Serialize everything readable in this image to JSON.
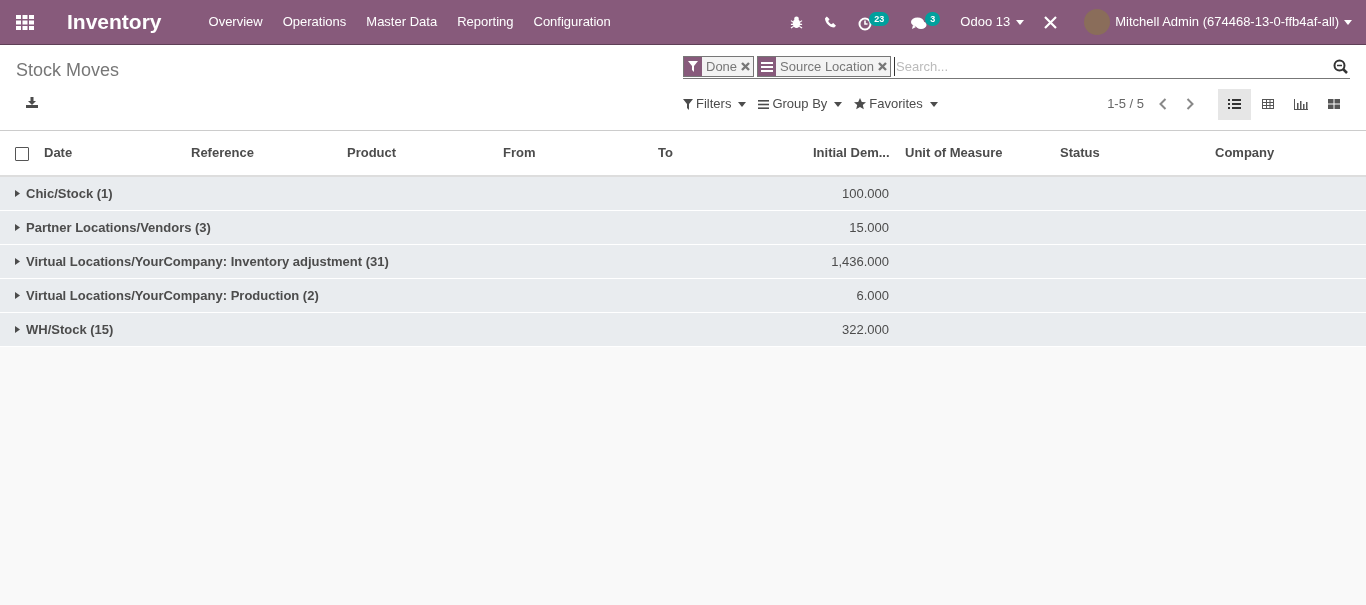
{
  "navbar": {
    "app_name": "Inventory",
    "menu": [
      "Overview",
      "Operations",
      "Master Data",
      "Reporting",
      "Configuration"
    ],
    "activity_count": "23",
    "message_count": "3",
    "database": "Odoo 13",
    "user": "Mitchell Admin (674468-13-0-ffb4af-all)"
  },
  "control_panel": {
    "title": "Stock Moves",
    "facets": [
      {
        "kind": "filter",
        "label": "Done"
      },
      {
        "kind": "groupby",
        "label": "Source Location"
      }
    ],
    "search": {
      "placeholder": "Search..."
    },
    "search_menus": [
      {
        "kind": "filter",
        "label": "Filters"
      },
      {
        "kind": "groupby",
        "label": "Group By"
      },
      {
        "kind": "favorite",
        "label": "Favorites"
      }
    ],
    "pager": "1-5 / 5",
    "views": [
      {
        "kind": "list",
        "selected": true
      },
      {
        "kind": "pivot",
        "selected": false
      },
      {
        "kind": "graph",
        "selected": false
      },
      {
        "kind": "kanban",
        "selected": false
      }
    ]
  },
  "table": {
    "select_all_checked": false,
    "columns": [
      {
        "label": "Date",
        "kind": "text"
      },
      {
        "label": "Reference",
        "kind": "text"
      },
      {
        "label": "Product",
        "kind": "text"
      },
      {
        "label": "From",
        "kind": "text"
      },
      {
        "label": "To",
        "kind": "text"
      },
      {
        "label": "Initial Dem...",
        "kind": "number"
      },
      {
        "label": "Unit of Measure",
        "kind": "text"
      },
      {
        "label": "Status",
        "kind": "text"
      },
      {
        "label": "Company",
        "kind": "text"
      }
    ],
    "groups": [
      {
        "label": "Chic/Stock (1)",
        "initial_demand": "100.000",
        "expanded": false
      },
      {
        "label": "Partner Locations/Vendors (3)",
        "initial_demand": "15.000",
        "expanded": false
      },
      {
        "label": "Virtual Locations/YourCompany: Inventory adjustment (31)",
        "initial_demand": "1,436.000",
        "expanded": false
      },
      {
        "label": "Virtual Locations/YourCompany: Production (2)",
        "initial_demand": "6.000",
        "expanded": false
      },
      {
        "label": "WH/Stock (15)",
        "initial_demand": "322.000",
        "expanded": false
      }
    ]
  }
}
